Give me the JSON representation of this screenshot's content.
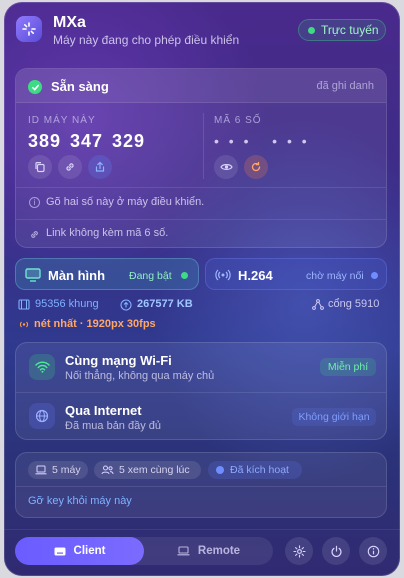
{
  "header": {
    "app_name": "MXa",
    "subtitle": "Máy này đang cho phép điều khiển",
    "status": "Trực tuyến"
  },
  "session": {
    "status_label": "Sẵn sàng",
    "registered": "đã ghi danh",
    "id_label": "ID MÁY NÀY",
    "id_parts": [
      "389",
      "347",
      "329"
    ],
    "pin_label": "MÃ 6 SỐ",
    "pin_mask": "• • •   • • •",
    "hint_share": "Gõ hai số này ở máy điều khiển.",
    "hint_link": "Link không kèm mã 6 số."
  },
  "stream": {
    "screen_label": "Màn hình",
    "screen_status": "Đang bật",
    "codec_label": "H.264",
    "codec_status": "chờ máy nối",
    "frames": "95356 khung",
    "bytes": "267577 KB",
    "port": "cổng 5910",
    "quality": "nét nhất · 1920px 30fps"
  },
  "connections": {
    "wifi_title": "Cùng mạng Wi-Fi",
    "wifi_desc": "Nối thẳng, không qua máy chủ",
    "wifi_badge": "Miễn phí",
    "internet_title": "Qua Internet",
    "internet_desc": "Đã mua bản đầy đủ",
    "internet_badge": "Không giới hạn"
  },
  "license": {
    "machines": "5 máy",
    "viewers": "5 xem cùng lúc",
    "activated": "Đã kích hoạt",
    "remove_link": "Gỡ key khỏi máy này"
  },
  "footer": {
    "client_tab": "Client",
    "remote_tab": "Remote"
  },
  "colors": {
    "accent": "#7b61ff",
    "online_green": "#3ddc84",
    "blue_text": "#7fb2ff",
    "orange": "#ff9a4a"
  }
}
